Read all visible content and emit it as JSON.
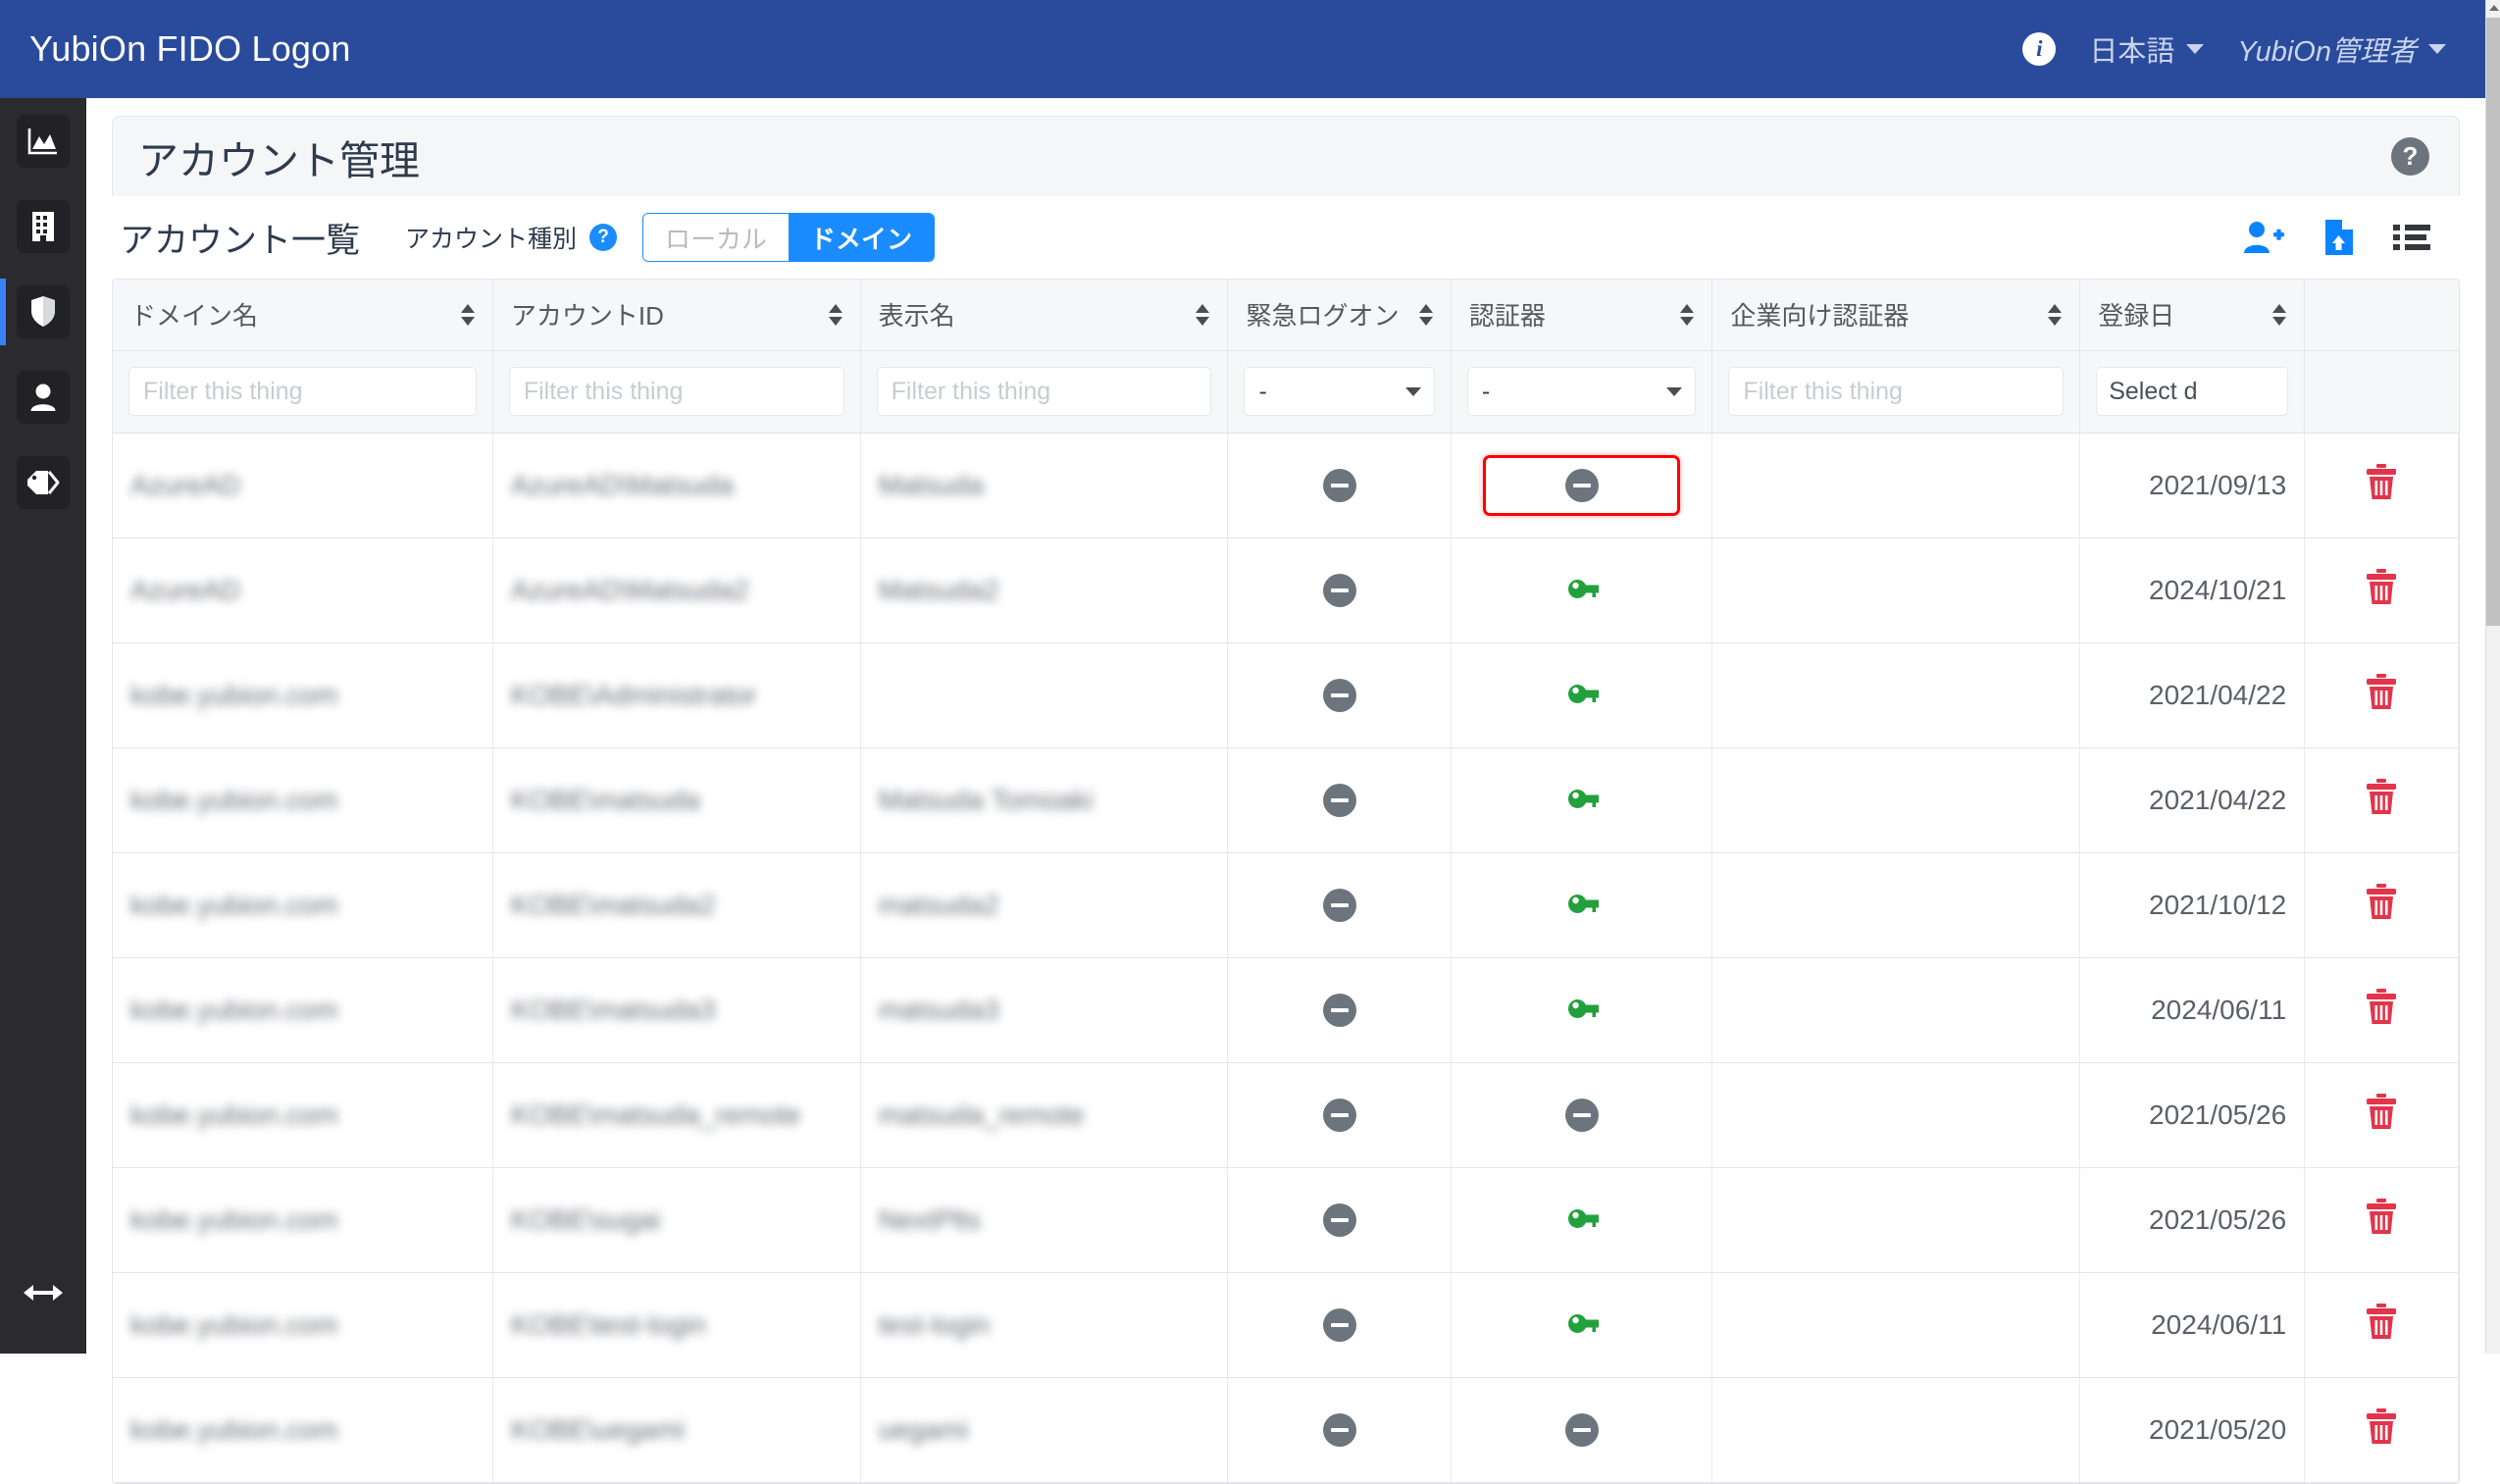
{
  "header": {
    "brand": "YubiOn FIDO Logon",
    "info_icon": "info-icon",
    "language": "日本語",
    "user": "YubiOn管理者"
  },
  "sidebar": {
    "items": [
      {
        "name": "dashboard",
        "icon": "chart-area-icon",
        "active": false
      },
      {
        "name": "organization",
        "icon": "building-icon",
        "active": false
      },
      {
        "name": "security",
        "icon": "shield-icon",
        "active": true
      },
      {
        "name": "accounts",
        "icon": "user-icon",
        "active": false
      },
      {
        "name": "tags",
        "icon": "tags-icon",
        "active": false
      }
    ],
    "collapse_icon": "arrows-left-right-icon"
  },
  "page": {
    "title": "アカウント管理",
    "help_icon_label": "?",
    "list_title": "アカウント一覧",
    "account_type_label": "アカウント種別",
    "account_type_help": "?",
    "toggle": {
      "local": "ローカル",
      "domain": "ドメイン",
      "selected": "ドメイン"
    },
    "actions": [
      {
        "name": "add-user-button",
        "icon": "user-plus-icon",
        "color": "#0a84ff"
      },
      {
        "name": "import-file-button",
        "icon": "file-upload-icon",
        "color": "#0a84ff"
      },
      {
        "name": "column-list-button",
        "icon": "list-icon",
        "color": "#34383d"
      }
    ]
  },
  "table": {
    "columns": [
      {
        "key": "domain",
        "label": "ドメイン名",
        "sortable": true
      },
      {
        "key": "account",
        "label": "アカウントID",
        "sortable": true
      },
      {
        "key": "display",
        "label": "表示名",
        "sortable": true
      },
      {
        "key": "emlogon",
        "label": "緊急ログオン",
        "sortable": true
      },
      {
        "key": "auth",
        "label": "認証器",
        "sortable": true
      },
      {
        "key": "entauth",
        "label": "企業向け認証器",
        "sortable": true
      },
      {
        "key": "regdate",
        "label": "登録日",
        "sortable": true
      },
      {
        "key": "delete",
        "label": "",
        "sortable": false
      }
    ],
    "filters": {
      "domain": {
        "type": "text",
        "placeholder": "Filter this thing",
        "value": ""
      },
      "account": {
        "type": "text",
        "placeholder": "Filter this thing",
        "value": ""
      },
      "display": {
        "type": "text",
        "placeholder": "Filter this thing",
        "value": ""
      },
      "emlogon": {
        "type": "select",
        "value": "-"
      },
      "auth": {
        "type": "select",
        "value": "-"
      },
      "entauth": {
        "type": "text",
        "placeholder": "Filter this thing",
        "value": ""
      },
      "regdate": {
        "type": "date",
        "value": "Select d"
      }
    },
    "rows": [
      {
        "domain": "AzureAD",
        "account": "AzureAD\\Matsuda",
        "display": "Matsuda",
        "emlogon": "disabled",
        "auth": "disabled",
        "auth_highlight": true,
        "entauth": "",
        "regdate": "2021/09/13"
      },
      {
        "domain": "AzureAD",
        "account": "AzureAD\\Matsuda2",
        "display": "Matsuda2",
        "emlogon": "disabled",
        "auth": "key",
        "auth_highlight": false,
        "entauth": "",
        "regdate": "2024/10/21"
      },
      {
        "domain": "kobe.yubion.com",
        "account": "KOBE\\Administrator",
        "display": "",
        "emlogon": "disabled",
        "auth": "key",
        "auth_highlight": false,
        "entauth": "",
        "regdate": "2021/04/22"
      },
      {
        "domain": "kobe.yubion.com",
        "account": "KOBE\\matsuda",
        "display": "Matsuda Tomoaki",
        "emlogon": "disabled",
        "auth": "key",
        "auth_highlight": false,
        "entauth": "",
        "regdate": "2021/04/22"
      },
      {
        "domain": "kobe.yubion.com",
        "account": "KOBE\\matsuda2",
        "display": "matsuda2",
        "emlogon": "disabled",
        "auth": "key",
        "auth_highlight": false,
        "entauth": "",
        "regdate": "2021/10/12"
      },
      {
        "domain": "kobe.yubion.com",
        "account": "KOBE\\matsuda3",
        "display": "matsuda3",
        "emlogon": "disabled",
        "auth": "key",
        "auth_highlight": false,
        "entauth": "",
        "regdate": "2024/06/11"
      },
      {
        "domain": "kobe.yubion.com",
        "account": "KOBE\\matsuda_remote",
        "display": "matsuda_remote",
        "emlogon": "disabled",
        "auth": "disabled",
        "auth_highlight": false,
        "entauth": "",
        "regdate": "2021/05/26"
      },
      {
        "domain": "kobe.yubion.com",
        "account": "KOBE\\sugai",
        "display": "NextPlts",
        "emlogon": "disabled",
        "auth": "key",
        "auth_highlight": false,
        "entauth": "",
        "regdate": "2021/05/26"
      },
      {
        "domain": "kobe.yubion.com",
        "account": "KOBE\\test-login",
        "display": "test-login",
        "emlogon": "disabled",
        "auth": "key",
        "auth_highlight": false,
        "entauth": "",
        "regdate": "2024/06/11"
      },
      {
        "domain": "kobe.yubion.com",
        "account": "KOBE\\uegami",
        "display": "uegami",
        "emlogon": "disabled",
        "auth": "disabled",
        "auth_highlight": false,
        "entauth": "",
        "regdate": "2021/05/20"
      }
    ],
    "delete_icon": "trash-icon"
  },
  "colors": {
    "header_blue": "#2a4b9b",
    "accent_blue": "#1a8cff",
    "sidebar_dark": "#2b2b2f",
    "key_green": "#22a03c",
    "disabled_gray": "#6c757d",
    "delete_red": "#e2344a",
    "highlight_red": "#ff0000"
  }
}
